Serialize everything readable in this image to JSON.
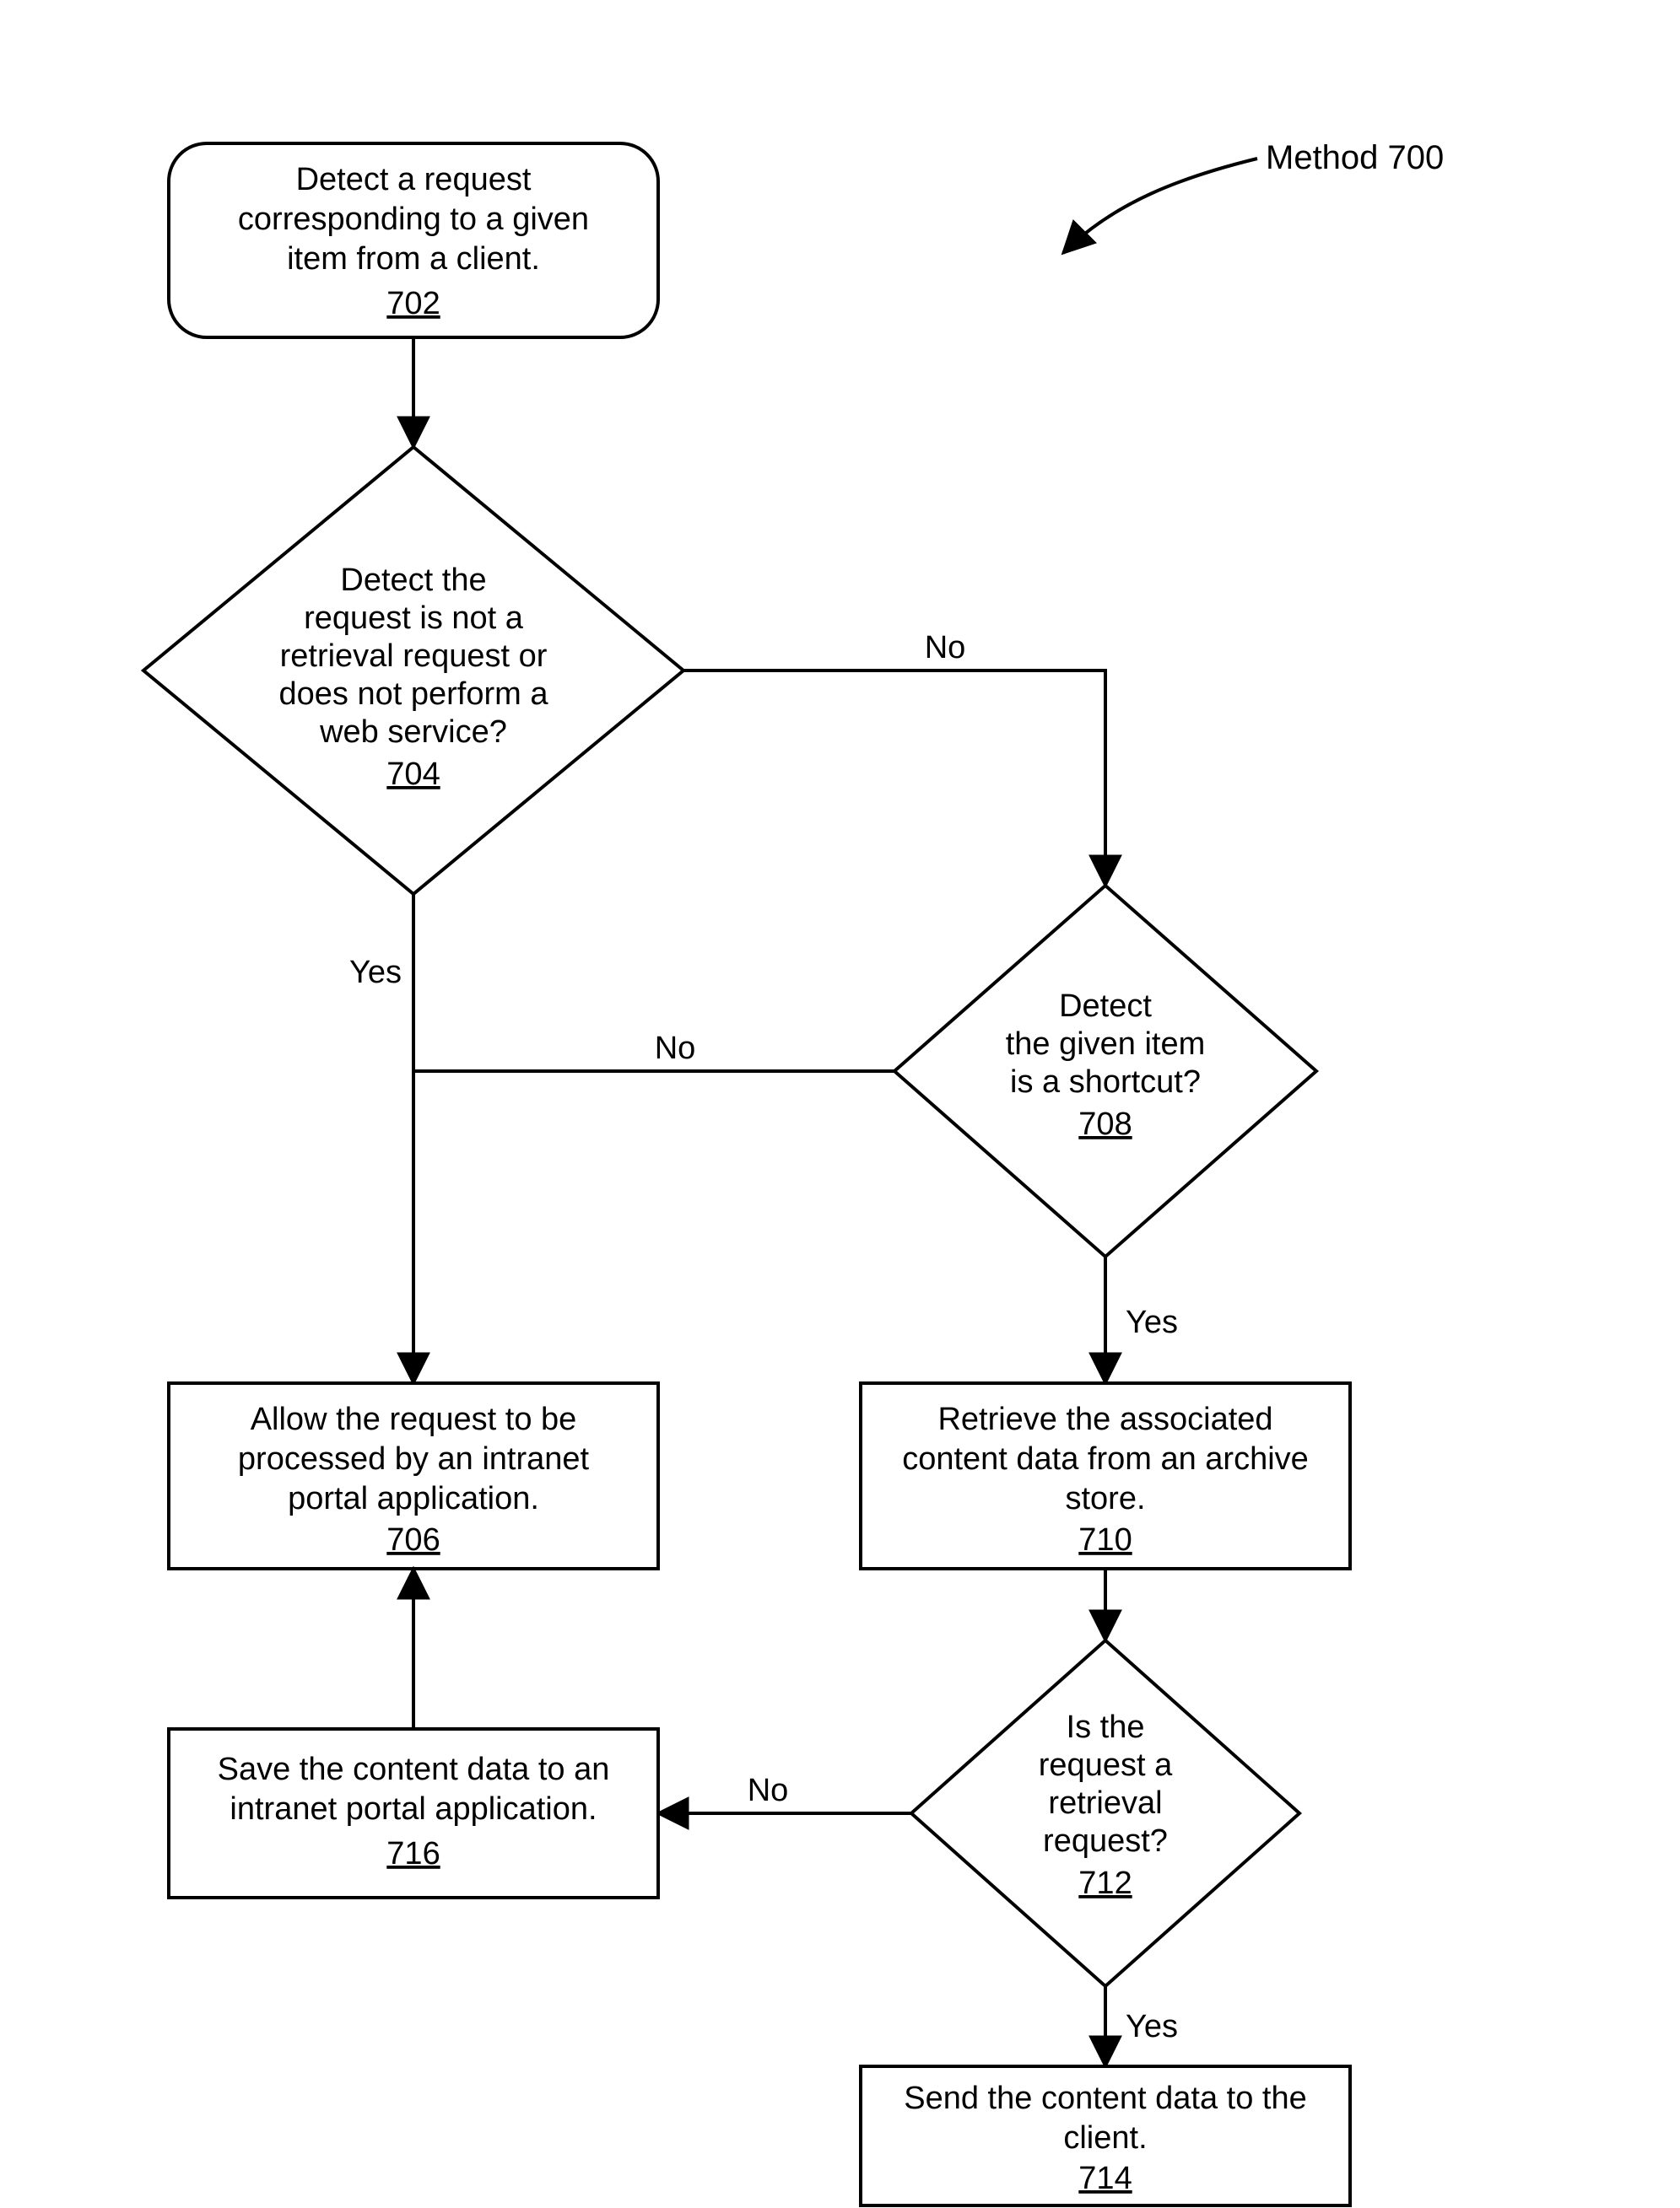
{
  "title": "Method 700",
  "nodes": {
    "n702": {
      "text": "Detect a request corresponding to a given item from a client.",
      "ref": "702"
    },
    "n704": {
      "text": "Detect the request is not a retrieval request or does not perform a web service?",
      "ref": "704"
    },
    "n706": {
      "text": "Allow the request to be processed by an intranet portal application.",
      "ref": "706"
    },
    "n708": {
      "text": "Detect the given item is a shortcut?",
      "ref": "708"
    },
    "n710": {
      "text": "Retrieve the associated content data from an archive store.",
      "ref": "710"
    },
    "n712": {
      "text": "Is the request a retrieval request?",
      "ref": "712"
    },
    "n714": {
      "text": "Send the content data to the client.",
      "ref": "714"
    },
    "n716": {
      "text": "Save the content data to an intranet portal application.",
      "ref": "716"
    }
  },
  "edges": {
    "e704_yes": "Yes",
    "e704_no": "No",
    "e708_yes": "Yes",
    "e708_no": "No",
    "e712_yes": "Yes",
    "e712_no": "No"
  }
}
